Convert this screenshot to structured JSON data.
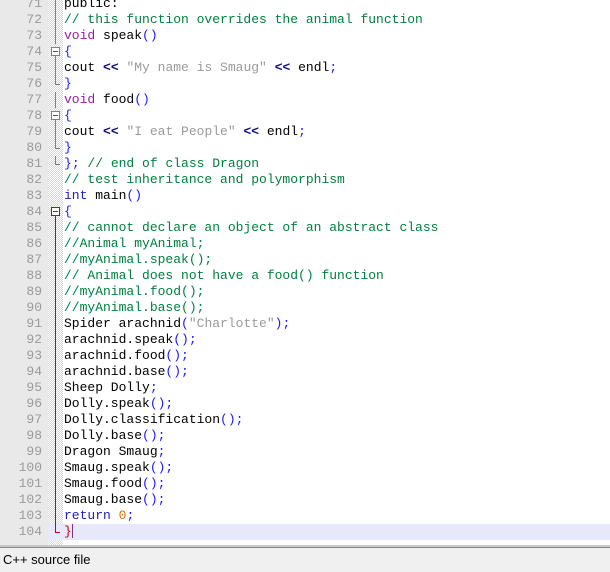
{
  "window": {
    "type": "code-editor",
    "language": "C++"
  },
  "statusbar": {
    "text": "C++ source file"
  },
  "editor": {
    "first_visible_line": 71,
    "last_visible_line": 104,
    "cursor_line": 104,
    "colors": {
      "background": "#ffffff",
      "gutter": "#e9e9e9",
      "line_number": "#9a9a9a",
      "current_line_highlight": "#e8e8fb",
      "comment": "#008040",
      "string": "#9b9b9b",
      "keyword": "#2020c0",
      "type": "#9b1aa0",
      "number": "#d07000",
      "punctuation": "#1a1aff",
      "operator": "#101080",
      "unmatched_brace": "#d00000",
      "fold_line": "#808080",
      "fold_line_active": "#d00000",
      "caret": "#7030a0"
    },
    "lines": [
      {
        "n": 71,
        "clipped": true,
        "fold": "line",
        "tokens": [
          {
            "t": "plain",
            "s": "public:"
          }
        ]
      },
      {
        "n": 72,
        "fold": "line",
        "tokens": [
          {
            "t": "comment",
            "s": "// this function overrides the animal function"
          }
        ]
      },
      {
        "n": 73,
        "fold": "line",
        "tokens": [
          {
            "t": "type",
            "s": "void"
          },
          {
            "t": "plain",
            "s": " speak"
          },
          {
            "t": "punct",
            "s": "()"
          }
        ]
      },
      {
        "n": 74,
        "fold": "box",
        "tokens": [
          {
            "t": "brace",
            "s": "{"
          }
        ]
      },
      {
        "n": 75,
        "fold": "line",
        "tokens": [
          {
            "t": "plain",
            "s": "cout "
          },
          {
            "t": "op",
            "s": "<<"
          },
          {
            "t": "plain",
            "s": " "
          },
          {
            "t": "str",
            "s": "\"My name is Smaug\""
          },
          {
            "t": "plain",
            "s": " "
          },
          {
            "t": "op",
            "s": "<<"
          },
          {
            "t": "plain",
            "s": " endl"
          },
          {
            "t": "punct",
            "s": ";"
          }
        ]
      },
      {
        "n": 76,
        "fold": "end",
        "tokens": [
          {
            "t": "brace",
            "s": "}"
          }
        ]
      },
      {
        "n": 77,
        "fold": "line",
        "tokens": [
          {
            "t": "type",
            "s": "void"
          },
          {
            "t": "plain",
            "s": " food"
          },
          {
            "t": "punct",
            "s": "()"
          }
        ]
      },
      {
        "n": 78,
        "fold": "box",
        "tokens": [
          {
            "t": "brace",
            "s": "{"
          }
        ]
      },
      {
        "n": 79,
        "fold": "line",
        "tokens": [
          {
            "t": "plain",
            "s": "cout "
          },
          {
            "t": "op",
            "s": "<<"
          },
          {
            "t": "plain",
            "s": " "
          },
          {
            "t": "str",
            "s": "\"I eat People\""
          },
          {
            "t": "plain",
            "s": " "
          },
          {
            "t": "op",
            "s": "<<"
          },
          {
            "t": "plain",
            "s": " endl"
          },
          {
            "t": "punct",
            "s": ";"
          }
        ]
      },
      {
        "n": 80,
        "fold": "end",
        "tokens": [
          {
            "t": "brace",
            "s": "}"
          }
        ]
      },
      {
        "n": 81,
        "fold": "end",
        "tokens": [
          {
            "t": "brace",
            "s": "}"
          },
          {
            "t": "punct",
            "s": ";"
          },
          {
            "t": "comment",
            "s": " // end of class Dragon"
          }
        ]
      },
      {
        "n": 82,
        "fold": "none",
        "tokens": [
          {
            "t": "comment",
            "s": "// test inheritance and polymorphism"
          }
        ]
      },
      {
        "n": 83,
        "fold": "none",
        "tokens": [
          {
            "t": "kw",
            "s": "int"
          },
          {
            "t": "plain",
            "s": " main"
          },
          {
            "t": "punct",
            "s": "()"
          }
        ]
      },
      {
        "n": 84,
        "fold": "box-red",
        "tokens": [
          {
            "t": "brace",
            "s": "{"
          }
        ]
      },
      {
        "n": 85,
        "fold": "line-red",
        "tokens": [
          {
            "t": "comment",
            "s": "// cannot declare an object of an abstract class"
          }
        ]
      },
      {
        "n": 86,
        "fold": "line-red",
        "tokens": [
          {
            "t": "comment",
            "s": "//Animal myAnimal;"
          }
        ]
      },
      {
        "n": 87,
        "fold": "line-red",
        "tokens": [
          {
            "t": "comment",
            "s": "//myAnimal.speak();"
          }
        ]
      },
      {
        "n": 88,
        "fold": "line-red",
        "tokens": [
          {
            "t": "comment",
            "s": "// Animal does not have a food() function"
          }
        ]
      },
      {
        "n": 89,
        "fold": "line-red",
        "tokens": [
          {
            "t": "comment",
            "s": "//myAnimal.food();"
          }
        ]
      },
      {
        "n": 90,
        "fold": "line-red",
        "tokens": [
          {
            "t": "comment",
            "s": "//myAnimal.base();"
          }
        ]
      },
      {
        "n": 91,
        "fold": "line-red",
        "tokens": [
          {
            "t": "plain",
            "s": "Spider arachnid"
          },
          {
            "t": "punct",
            "s": "("
          },
          {
            "t": "str",
            "s": "\"Charlotte\""
          },
          {
            "t": "punct",
            "s": ");"
          }
        ]
      },
      {
        "n": 92,
        "fold": "line-red",
        "tokens": [
          {
            "t": "plain",
            "s": "arachnid.speak"
          },
          {
            "t": "punct",
            "s": "();"
          }
        ]
      },
      {
        "n": 93,
        "fold": "line-red",
        "tokens": [
          {
            "t": "plain",
            "s": "arachnid.food"
          },
          {
            "t": "punct",
            "s": "();"
          }
        ]
      },
      {
        "n": 94,
        "fold": "line-red",
        "tokens": [
          {
            "t": "plain",
            "s": "arachnid.base"
          },
          {
            "t": "punct",
            "s": "();"
          }
        ]
      },
      {
        "n": 95,
        "fold": "line-red",
        "tokens": [
          {
            "t": "plain",
            "s": "Sheep Dolly"
          },
          {
            "t": "punct",
            "s": ";"
          }
        ]
      },
      {
        "n": 96,
        "fold": "line-red",
        "tokens": [
          {
            "t": "plain",
            "s": "Dolly.speak"
          },
          {
            "t": "punct",
            "s": "();"
          }
        ]
      },
      {
        "n": 97,
        "fold": "line-red",
        "tokens": [
          {
            "t": "plain",
            "s": "Dolly.classification"
          },
          {
            "t": "punct",
            "s": "();"
          }
        ]
      },
      {
        "n": 98,
        "fold": "line-red",
        "tokens": [
          {
            "t": "plain",
            "s": "Dolly.base"
          },
          {
            "t": "punct",
            "s": "();"
          }
        ]
      },
      {
        "n": 99,
        "fold": "line-red",
        "tokens": [
          {
            "t": "plain",
            "s": "Dragon Smaug"
          },
          {
            "t": "punct",
            "s": ";"
          }
        ]
      },
      {
        "n": 100,
        "fold": "line-red",
        "tokens": [
          {
            "t": "plain",
            "s": "Smaug.speak"
          },
          {
            "t": "punct",
            "s": "();"
          }
        ]
      },
      {
        "n": 101,
        "fold": "line-red",
        "tokens": [
          {
            "t": "plain",
            "s": "Smaug.food"
          },
          {
            "t": "punct",
            "s": "();"
          }
        ]
      },
      {
        "n": 102,
        "fold": "line-red",
        "tokens": [
          {
            "t": "plain",
            "s": "Smaug.base"
          },
          {
            "t": "punct",
            "s": "();"
          }
        ]
      },
      {
        "n": 103,
        "fold": "line-red",
        "tokens": [
          {
            "t": "kw",
            "s": "return"
          },
          {
            "t": "plain",
            "s": " "
          },
          {
            "t": "num",
            "s": "0"
          },
          {
            "t": "punct",
            "s": ";"
          }
        ]
      },
      {
        "n": 104,
        "fold": "end-red",
        "current": true,
        "caret": true,
        "tokens": [
          {
            "t": "redbrace",
            "s": "}"
          }
        ]
      }
    ]
  }
}
